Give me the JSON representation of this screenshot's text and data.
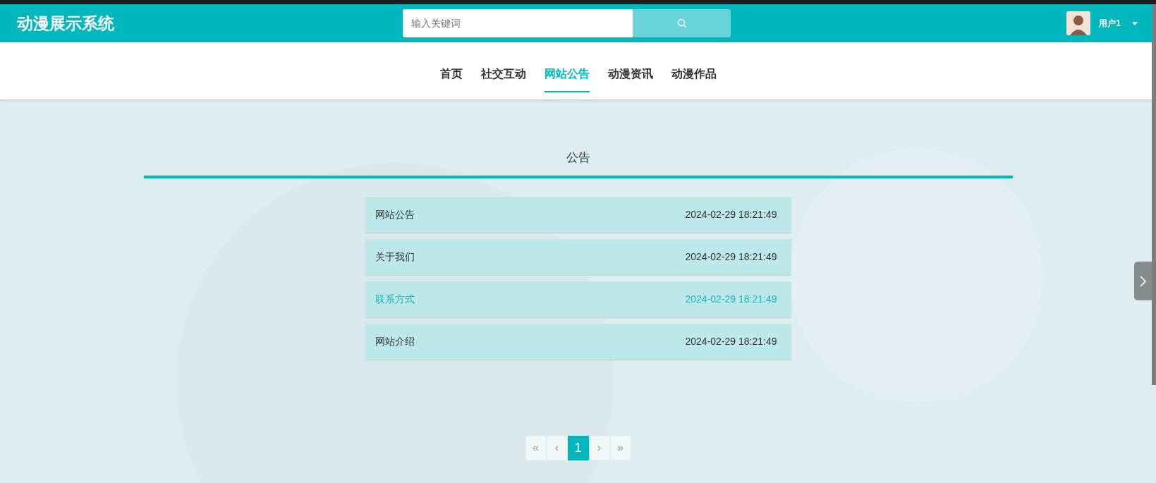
{
  "header": {
    "logo": "动漫展示系统",
    "search": {
      "placeholder": "输入关键词"
    },
    "user": {
      "name": "用户1"
    }
  },
  "nav": [
    {
      "label": "首页",
      "selected": false
    },
    {
      "label": "社交互动",
      "selected": false
    },
    {
      "label": "网站公告",
      "selected": true
    },
    {
      "label": "动漫资讯",
      "selected": false
    },
    {
      "label": "动漫作品",
      "selected": false
    }
  ],
  "section": {
    "title": "公告"
  },
  "notices": [
    {
      "title": "网站公告",
      "time": "2024-02-29 18:21:49",
      "highlighted": false
    },
    {
      "title": "关于我们",
      "time": "2024-02-29 18:21:49",
      "highlighted": false
    },
    {
      "title": "联系方式",
      "time": "2024-02-29 18:21:49",
      "highlighted": true
    },
    {
      "title": "网站介绍",
      "time": "2024-02-29 18:21:49",
      "highlighted": false
    }
  ],
  "pagination": [
    {
      "label": "«",
      "selected": false
    },
    {
      "label": "‹",
      "selected": false
    },
    {
      "label": "1",
      "selected": true
    },
    {
      "label": "›",
      "selected": false
    },
    {
      "label": "»",
      "selected": false
    }
  ]
}
